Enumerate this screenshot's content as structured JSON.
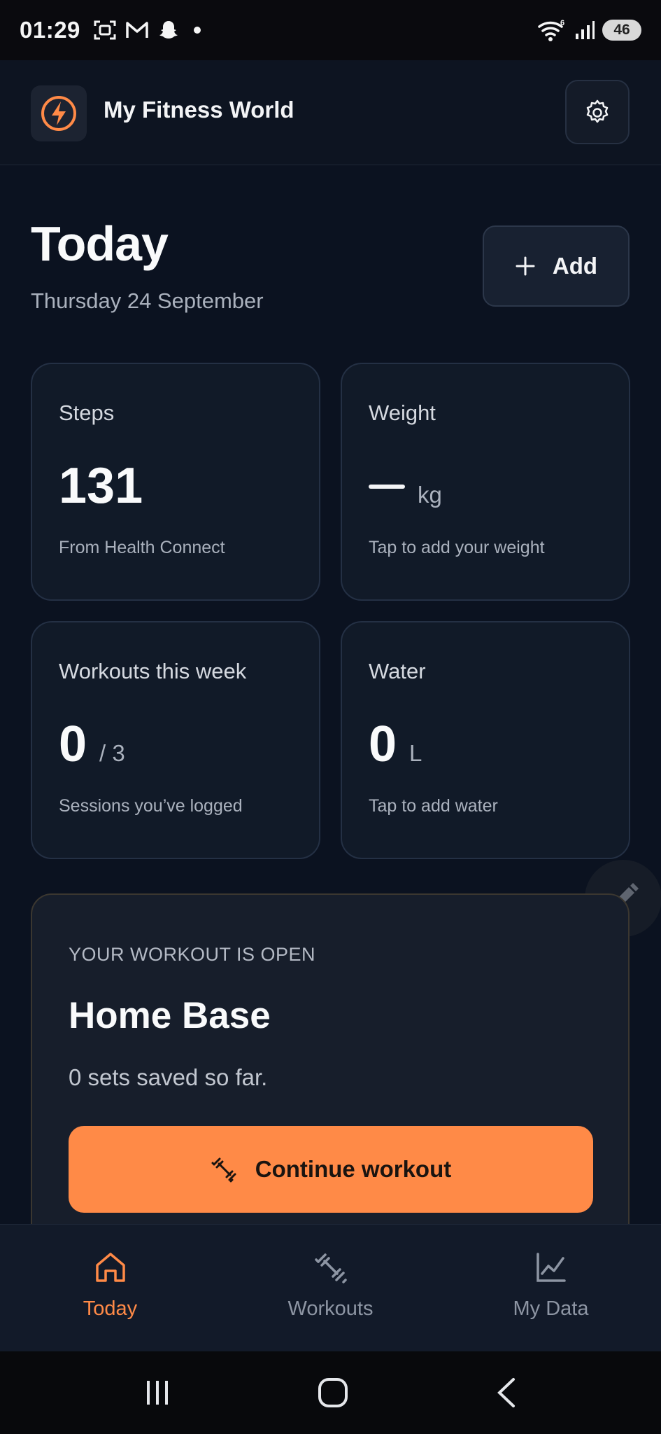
{
  "status_bar": {
    "time": "01:29",
    "battery": "46",
    "icons_left": [
      "screenshot-icon",
      "gmail-icon",
      "snapchat-icon",
      "notification-dot"
    ],
    "icons_right": [
      "wifi-icon",
      "signal-icon",
      "battery-icon"
    ]
  },
  "header": {
    "app_title": "My Fitness World",
    "logo_icon": "lightning-icon",
    "settings_icon": "gear-icon"
  },
  "today": {
    "title": "Today",
    "date": "Thursday 24 September",
    "add_label": "Add"
  },
  "cards": {
    "steps": {
      "label": "Steps",
      "value": "131",
      "unit": "",
      "sub": "From Health Connect"
    },
    "weight": {
      "label": "Weight",
      "value": "—",
      "unit": "kg",
      "sub": "Tap to add your weight"
    },
    "workouts": {
      "label": "Workouts this week",
      "value": "0",
      "unit": "/ 3",
      "sub": "Sessions you’ve logged"
    },
    "water": {
      "label": "Water",
      "value": "0",
      "unit": "L",
      "sub": "Tap to add water"
    }
  },
  "workout_open": {
    "overline": "YOUR WORKOUT IS OPEN",
    "title": "Home Base",
    "sub": "0 sets saved so far.",
    "button_label": "Continue workout"
  },
  "bottom_nav": {
    "items": [
      {
        "label": "Today",
        "icon": "home-icon",
        "active": true
      },
      {
        "label": "Workouts",
        "icon": "dumbbell-icon",
        "active": false
      },
      {
        "label": "My Data",
        "icon": "line-chart-icon",
        "active": false
      }
    ]
  },
  "colors": {
    "accent": "#ff8a47",
    "background": "#0b1220",
    "card": "#111a28"
  }
}
